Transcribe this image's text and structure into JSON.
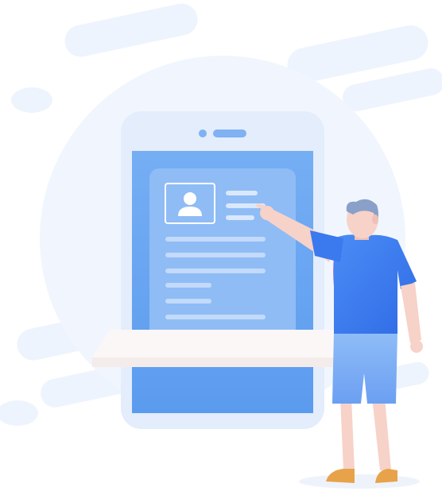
{
  "illustration": {
    "subject": "profile-card-on-phone-with-person-pointing"
  },
  "colors": {
    "background": "#ffffff",
    "blob": "#eef4fd",
    "phone_frame": "#e4eefc",
    "phone_screen": "#6aa6f0",
    "card": "#8fbcf5",
    "text_line": "#bcd6fa",
    "shelf": "#fbf6f5",
    "shirt": "#3f7ef2",
    "shorts": "#7fb2f6",
    "skin": "#f7d2c8",
    "hair": "#8aa0c8",
    "shoes": "#e7a24a"
  },
  "icons": {
    "avatar": "user-avatar-icon"
  }
}
